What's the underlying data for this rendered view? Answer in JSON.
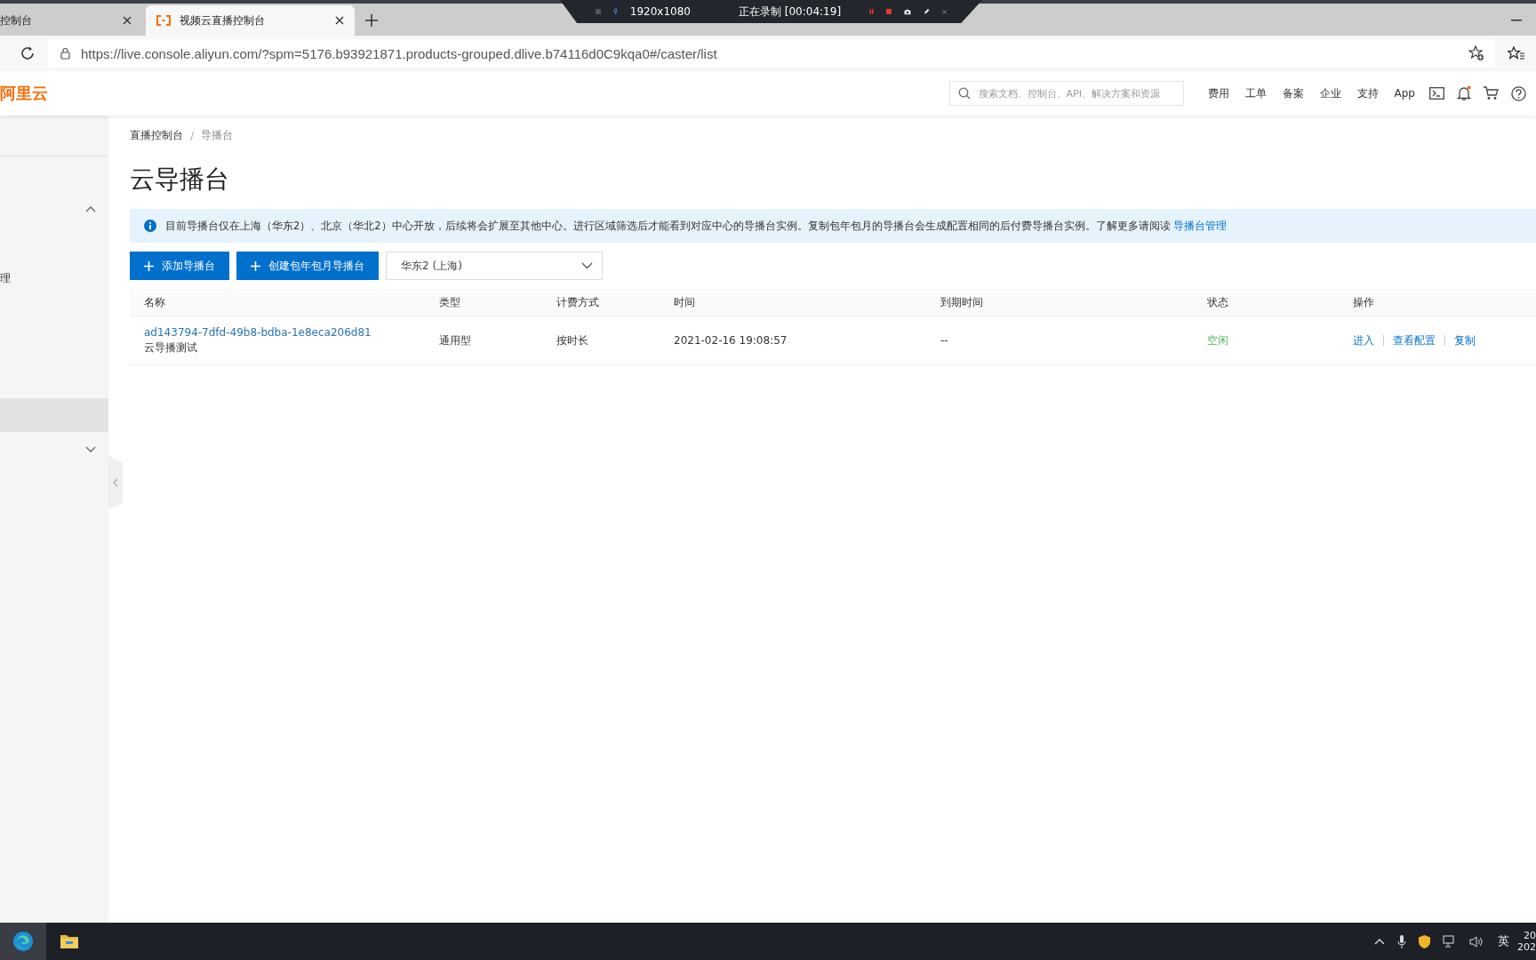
{
  "browser": {
    "tabs": [
      {
        "title": "控制台",
        "selected": false
      },
      {
        "title": "视频云直播控制台",
        "selected": true
      }
    ],
    "url": "https://live.console.aliyun.com/?spm=5176.b93921871.products-grouped.dlive.b74116d0C9kqa0#/caster/list"
  },
  "recorder": {
    "resolution": "1920x1080",
    "status": "正在录制 [00:04:19]"
  },
  "header": {
    "logo": "阿里云",
    "search": {
      "placeholder": "搜索文档、控制台、API、解决方案和资源"
    },
    "links": [
      "费用",
      "工单",
      "备案",
      "企业",
      "支持",
      "App"
    ]
  },
  "sidebar": {
    "items": [
      {
        "kind": "group",
        "expanded": true,
        "selected": false
      },
      {
        "label": "理",
        "kind": "item",
        "selected": false
      },
      {
        "kind": "item",
        "selected": true
      },
      {
        "kind": "group",
        "expanded": false,
        "selected": false
      }
    ]
  },
  "breadcrumb": [
    "直播控制台",
    "导播台"
  ],
  "breadcrumb_separator": "/",
  "title": "云导播台",
  "notice": {
    "text": "目前导播台仅在上海（华东2）、北京（华北2）中心开放，后续将会扩展至其他中心。进行区域筛选后才能看到对应中心的导播台实例。复制包年包月的导播台会生成配置相同的后付费导播台实例。了解更多请阅读",
    "link": "导播台管理"
  },
  "buttons": [
    "添加导播台",
    "创建包年包月导播台"
  ],
  "region_select": {
    "value": "华东2 (上海)"
  },
  "table": {
    "columns": [
      "名称",
      "类型",
      "计费方式",
      "时间",
      "到期时间",
      "状态",
      "操作"
    ],
    "rows": [
      {
        "id": "ad143794-7dfd-49b8-bdba-1e8eca206d81",
        "name": "云导播测试",
        "type": "通用型",
        "billing": "按时长",
        "time": "2021-02-16 19:08:57",
        "expires": "--",
        "status": "空闲",
        "actions": [
          "进入",
          "查看配置",
          "复制"
        ]
      }
    ]
  },
  "taskbar": {
    "ime": "英",
    "clock": [
      "20",
      "202"
    ]
  }
}
